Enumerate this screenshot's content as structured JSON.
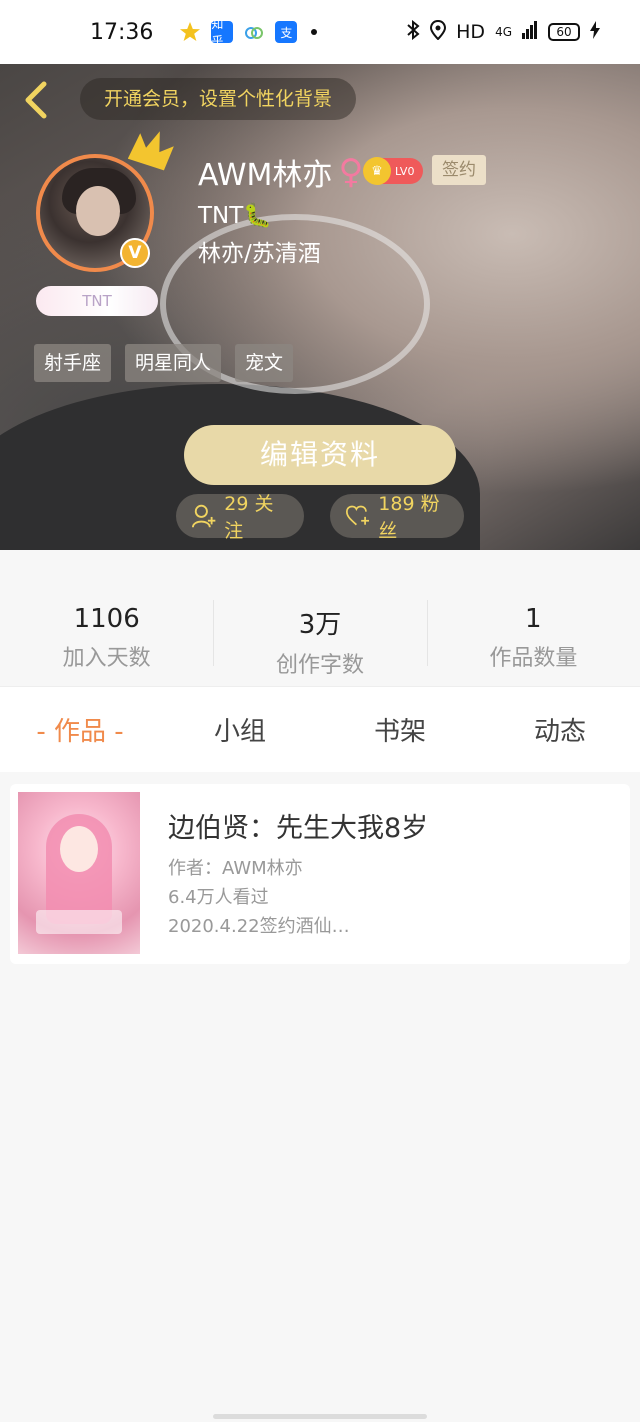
{
  "status_bar": {
    "time": "17:36",
    "app_icons": [
      "star-app-icon",
      "zhihu-icon",
      "cloud-app-icon",
      "alipay-icon"
    ],
    "zhihu_label": "知乎",
    "alipay_label": "支",
    "network": "HD",
    "signal": "4G",
    "battery": "60"
  },
  "header": {
    "promo": "开通会员，设置个性化背景",
    "username": "AWM林亦",
    "gender_symbol": "♀",
    "level": "LV0",
    "sign_badge": "签约",
    "fan_badge": "TNT",
    "bio_line1": "TNT🐛",
    "bio_line2": "林亦/苏清酒",
    "tags": [
      "射手座",
      "明星同人",
      "宠文"
    ],
    "edit_button": "编辑资料",
    "following": "29 关注",
    "fans": "189 粉丝",
    "verified_mark": "V"
  },
  "stats": [
    {
      "value": "1106",
      "label": "加入天数"
    },
    {
      "value": "3万",
      "label": "创作字数"
    },
    {
      "value": "1",
      "label": "作品数量"
    }
  ],
  "tabs": [
    "- 作品 -",
    "小组",
    "书架",
    "动态"
  ],
  "works": [
    {
      "title": "边伯贤：先生大我8岁",
      "author": "作者：AWM林亦",
      "views": "6.4万人看过",
      "note": "2020.4.22签约酒仙…"
    }
  ],
  "colors": {
    "accent_orange": "#f08a4b",
    "gold_text": "#f1d460",
    "edit_button_bg": "#e8d9a8"
  }
}
